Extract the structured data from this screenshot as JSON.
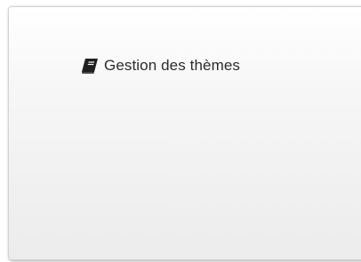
{
  "tile": {
    "label": "Gestion des thèmes",
    "icon": "book-icon"
  }
}
